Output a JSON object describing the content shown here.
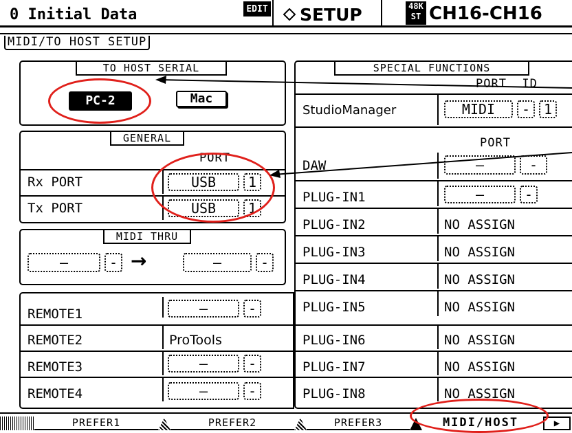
{
  "header": {
    "scene": "0 Initial Data",
    "edit_badge": "EDIT",
    "title": "SETUP",
    "title_icon": "diamond-icon",
    "rate_badge_top": "48K",
    "rate_badge_bottom": "ST",
    "channel": "CH16-CH16"
  },
  "page_title": "MIDI/TO HOST SETUP",
  "to_host_serial": {
    "title": "TO HOST SERIAL",
    "pc2": "PC-2",
    "mac": "Mac"
  },
  "general": {
    "title": "GENERAL",
    "port_header": "PORT",
    "rx_label": "Rx PORT",
    "rx_port": "USB",
    "rx_id": "1",
    "tx_label": "Tx PORT",
    "tx_port": "USB",
    "tx_id": "1"
  },
  "midi_thru": {
    "title": "MIDI THRU",
    "in_port": "—",
    "in_id": "-",
    "arrow": "→",
    "out_port": "—",
    "out_id": "-"
  },
  "remotes": [
    {
      "label": "REMOTE1",
      "port": "—",
      "id": "-"
    },
    {
      "label": "REMOTE2",
      "value": "ProTools"
    },
    {
      "label": "REMOTE3",
      "port": "—",
      "id": "-"
    },
    {
      "label": "REMOTE4",
      "port": "—",
      "id": "-"
    }
  ],
  "special": {
    "title": "SPECIAL FUNCTIONS",
    "port_id_header": "PORT  ID",
    "studio_manager_label": "StudioManager",
    "studio_manager_port": "MIDI",
    "studio_manager_dash": "-",
    "studio_manager_id": "1",
    "port_header": "PORT",
    "daw_label": "DAW",
    "daw_port": "—",
    "daw_id": "-",
    "plugins": [
      {
        "label": "PLUG-IN1",
        "port": "—",
        "id": "-"
      },
      {
        "label": "PLUG-IN2",
        "value": "NO ASSIGN"
      },
      {
        "label": "PLUG-IN3",
        "value": "NO ASSIGN"
      },
      {
        "label": "PLUG-IN4",
        "value": "NO ASSIGN"
      },
      {
        "label": "PLUG-IN5",
        "value": "NO ASSIGN"
      },
      {
        "label": "PLUG-IN6",
        "value": "NO ASSIGN"
      },
      {
        "label": "PLUG-IN7",
        "value": "NO ASSIGN"
      },
      {
        "label": "PLUG-IN8",
        "value": "NO ASSIGN"
      }
    ]
  },
  "tabs": [
    "PREFER1",
    "PREFER2",
    "PREFER3",
    "MIDI/HOST"
  ],
  "tab_next": "▶",
  "colors": {
    "annotation_red": "#e0201b",
    "lcd_black": "#000000"
  }
}
